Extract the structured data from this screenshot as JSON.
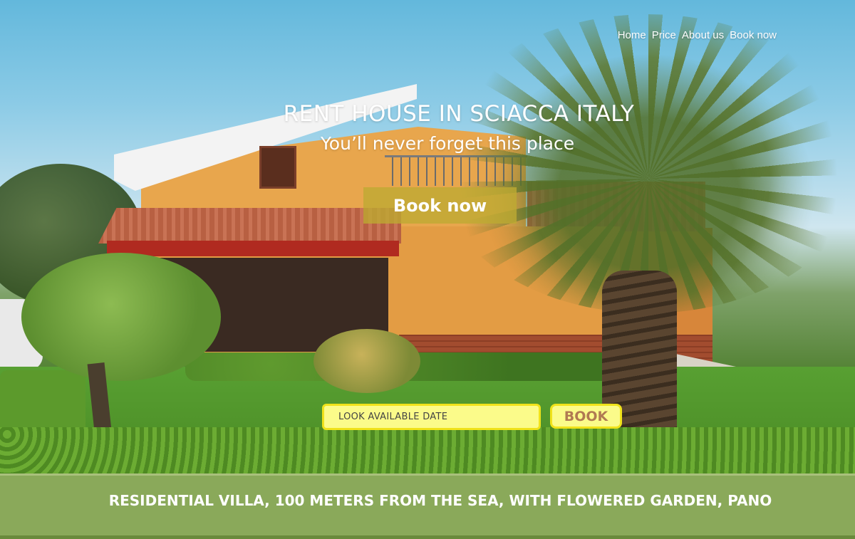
{
  "nav": {
    "items": [
      "Home",
      "Price",
      "About us",
      "Book now"
    ]
  },
  "hero": {
    "title": "RENT HOUSE IN SCIACCA ITALY",
    "subtitle": "You’ll never forget this place",
    "cta_label": "Book now"
  },
  "booking": {
    "date_placeholder": "LOOK AVAILABLE DATE",
    "book_label": "BOOK"
  },
  "banner": {
    "text": "RESIDENTIAL VILLA, 100 METERS FROM THE SEA, WITH FLOWERED GARDEN, PANO"
  },
  "colors": {
    "cta_background": "#beaa32",
    "input_background": "#fbfb8a",
    "input_border": "#f0e21a",
    "banner_background": "#8aa95a"
  }
}
